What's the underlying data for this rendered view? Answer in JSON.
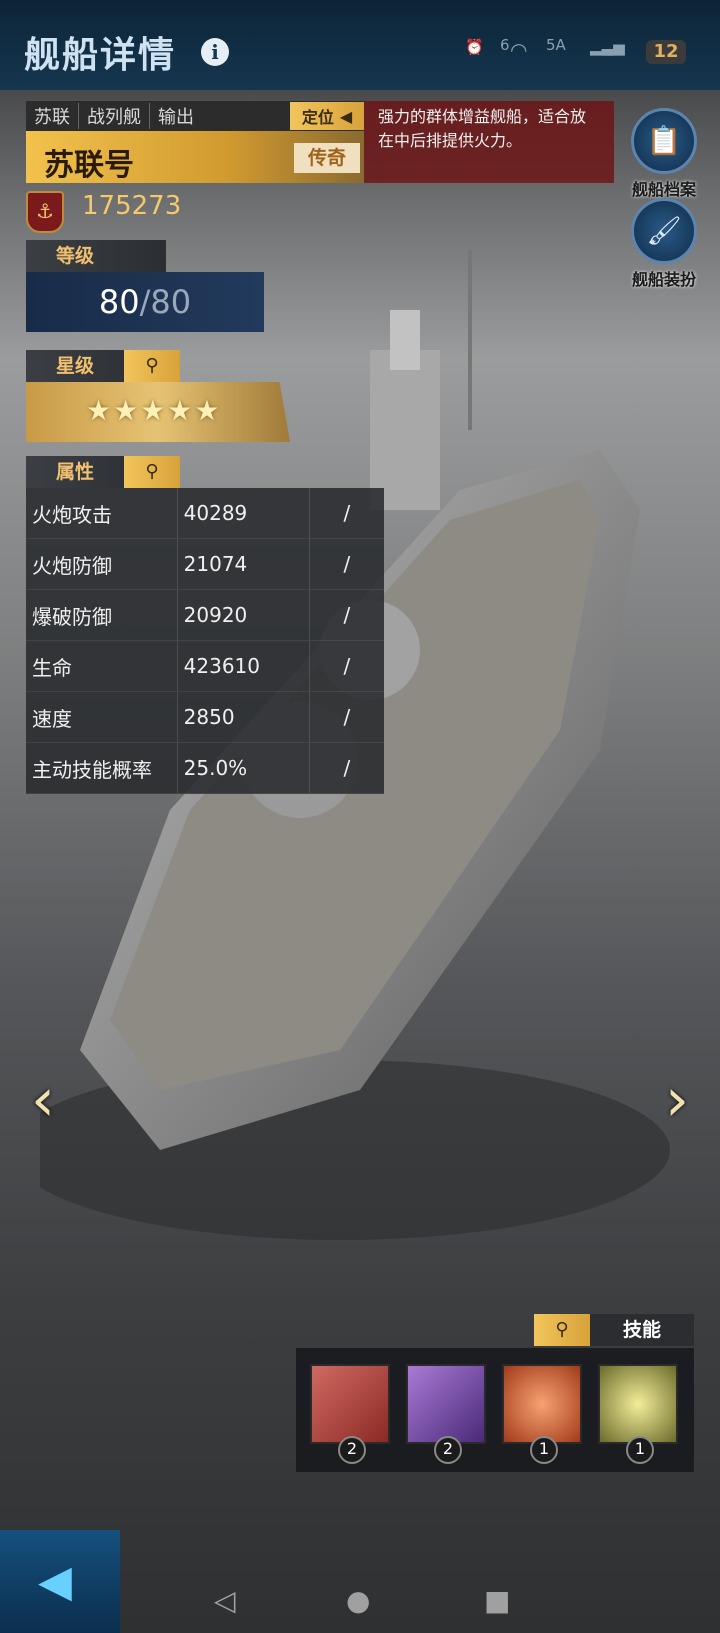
{
  "page": {
    "title": "舰船详情",
    "info_icon": "i"
  },
  "status": {
    "signal_label": "6",
    "network": "5A",
    "battery": "12"
  },
  "ship": {
    "tags": [
      "苏联",
      "战列舰",
      "输出"
    ],
    "role_label": "定位",
    "name": "苏联号",
    "rarity": "传奇",
    "description": "强力的群体增益舰船，适合放在中后排提供火力。",
    "power": "175273"
  },
  "level": {
    "label": "等级",
    "current": "80",
    "max": "/80"
  },
  "star": {
    "label": "星级",
    "stars": "★★★★★",
    "count": 5
  },
  "attributes": {
    "label": "属性",
    "rows": [
      {
        "name": "火炮攻击",
        "value": "40289",
        "extra": "/"
      },
      {
        "name": "火炮防御",
        "value": "21074",
        "extra": "/"
      },
      {
        "name": "爆破防御",
        "value": "20920",
        "extra": "/"
      },
      {
        "name": "生命",
        "value": "423610",
        "extra": "/"
      },
      {
        "name": "速度",
        "value": "2850",
        "extra": "/"
      },
      {
        "name": "主动技能概率",
        "value": "25.0%",
        "extra": "/"
      }
    ]
  },
  "side_menu": {
    "archive": "舰船档案",
    "dress": "舰船装扮"
  },
  "skills": {
    "label": "技能",
    "items": [
      {
        "level": "2",
        "color": "#c0504a"
      },
      {
        "level": "2",
        "color": "#7a4aa8"
      },
      {
        "level": "1",
        "color": "#d7643a"
      },
      {
        "level": "1",
        "color": "#b8b45a"
      }
    ]
  }
}
